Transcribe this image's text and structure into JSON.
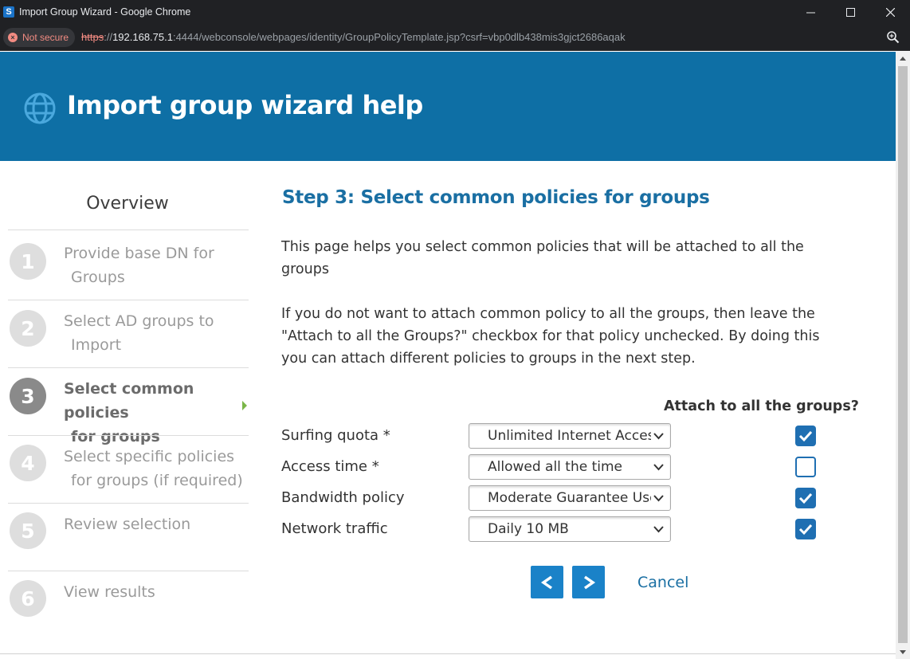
{
  "window": {
    "title": "Import Group Wizard - Google Chrome",
    "app_icon_letter": "S"
  },
  "addressbar": {
    "security_label": "Not secure",
    "url_scheme": "https",
    "url_sep": "://",
    "url_host": "192.168.75.1",
    "url_rest": ":4444/webconsole/webpages/identity/GroupPolicyTemplate.jsp?csrf=vbp0dlb438mis3gjct2686aqak"
  },
  "header": {
    "title": "Import group wizard help"
  },
  "sidebar": {
    "title": "Overview",
    "steps": [
      {
        "number": "1",
        "line1": "Provide base DN for",
        "line2": "Groups",
        "active": false
      },
      {
        "number": "2",
        "line1": "Select AD groups to",
        "line2": "Import",
        "active": false
      },
      {
        "number": "3",
        "line1": "Select common policies",
        "line2": "for groups",
        "active": true
      },
      {
        "number": "4",
        "line1": "Select specific policies",
        "line2": "for groups (if required)",
        "active": false
      },
      {
        "number": "5",
        "line1": "Review selection",
        "line2": "",
        "active": false
      },
      {
        "number": "6",
        "line1": "View results",
        "line2": "",
        "active": false
      }
    ]
  },
  "main": {
    "heading": "Step 3: Select common policies for groups",
    "para1": "This page helps you select common policies that will be attached to all the groups",
    "para2": "If you do not want to attach common policy to all the groups, then leave the \"Attach to all the Groups?\" checkbox for that policy unchecked. By doing this you can attach different policies to groups in the next step.",
    "attach_header": "Attach to all the groups?",
    "policies": [
      {
        "label": "Surfing quota *",
        "value": "Unlimited Internet Access",
        "checked": true
      },
      {
        "label": "Access time *",
        "value": "Allowed all the time",
        "checked": false
      },
      {
        "label": "Bandwidth policy",
        "value": "Moderate Guarantee User",
        "checked": true
      },
      {
        "label": "Network traffic",
        "value": "Daily 10 MB",
        "checked": true
      }
    ],
    "prev_label": "<",
    "next_label": ">",
    "cancel_label": "Cancel"
  },
  "colors": {
    "header_bg": "#0e6fa5",
    "accent": "#1a82c8",
    "heading": "#1a6fa3"
  }
}
